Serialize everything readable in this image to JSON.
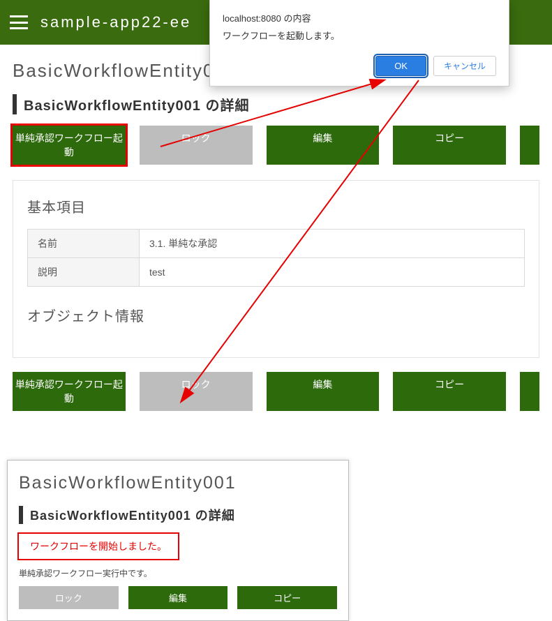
{
  "topbar": {
    "title": "sample-app22-ee"
  },
  "page": {
    "h1": "BasicWorkflowEntity001",
    "h2": "BasicWorkflowEntity001 の詳細"
  },
  "buttons": {
    "start_wf": "単純承認ワークフロー起動",
    "lock": "ロック",
    "edit": "編集",
    "copy": "コピー"
  },
  "card_basic": {
    "title": "基本項目",
    "rows": [
      {
        "label": "名前",
        "value": "3.1. 単純な承認"
      },
      {
        "label": "説明",
        "value": "test"
      }
    ]
  },
  "card_obj": {
    "title": "オブジェクト情報"
  },
  "dialog": {
    "title": "localhost:8080 の内容",
    "body": "ワークフローを起動します。",
    "ok": "OK",
    "cancel": "キャンセル"
  },
  "panel2": {
    "h1": "BasicWorkflowEntity001",
    "h2": "BasicWorkflowEntity001 の詳細",
    "started_msg": "ワークフローを開始しました。",
    "running_msg": "単純承認ワークフロー実行中です。"
  }
}
